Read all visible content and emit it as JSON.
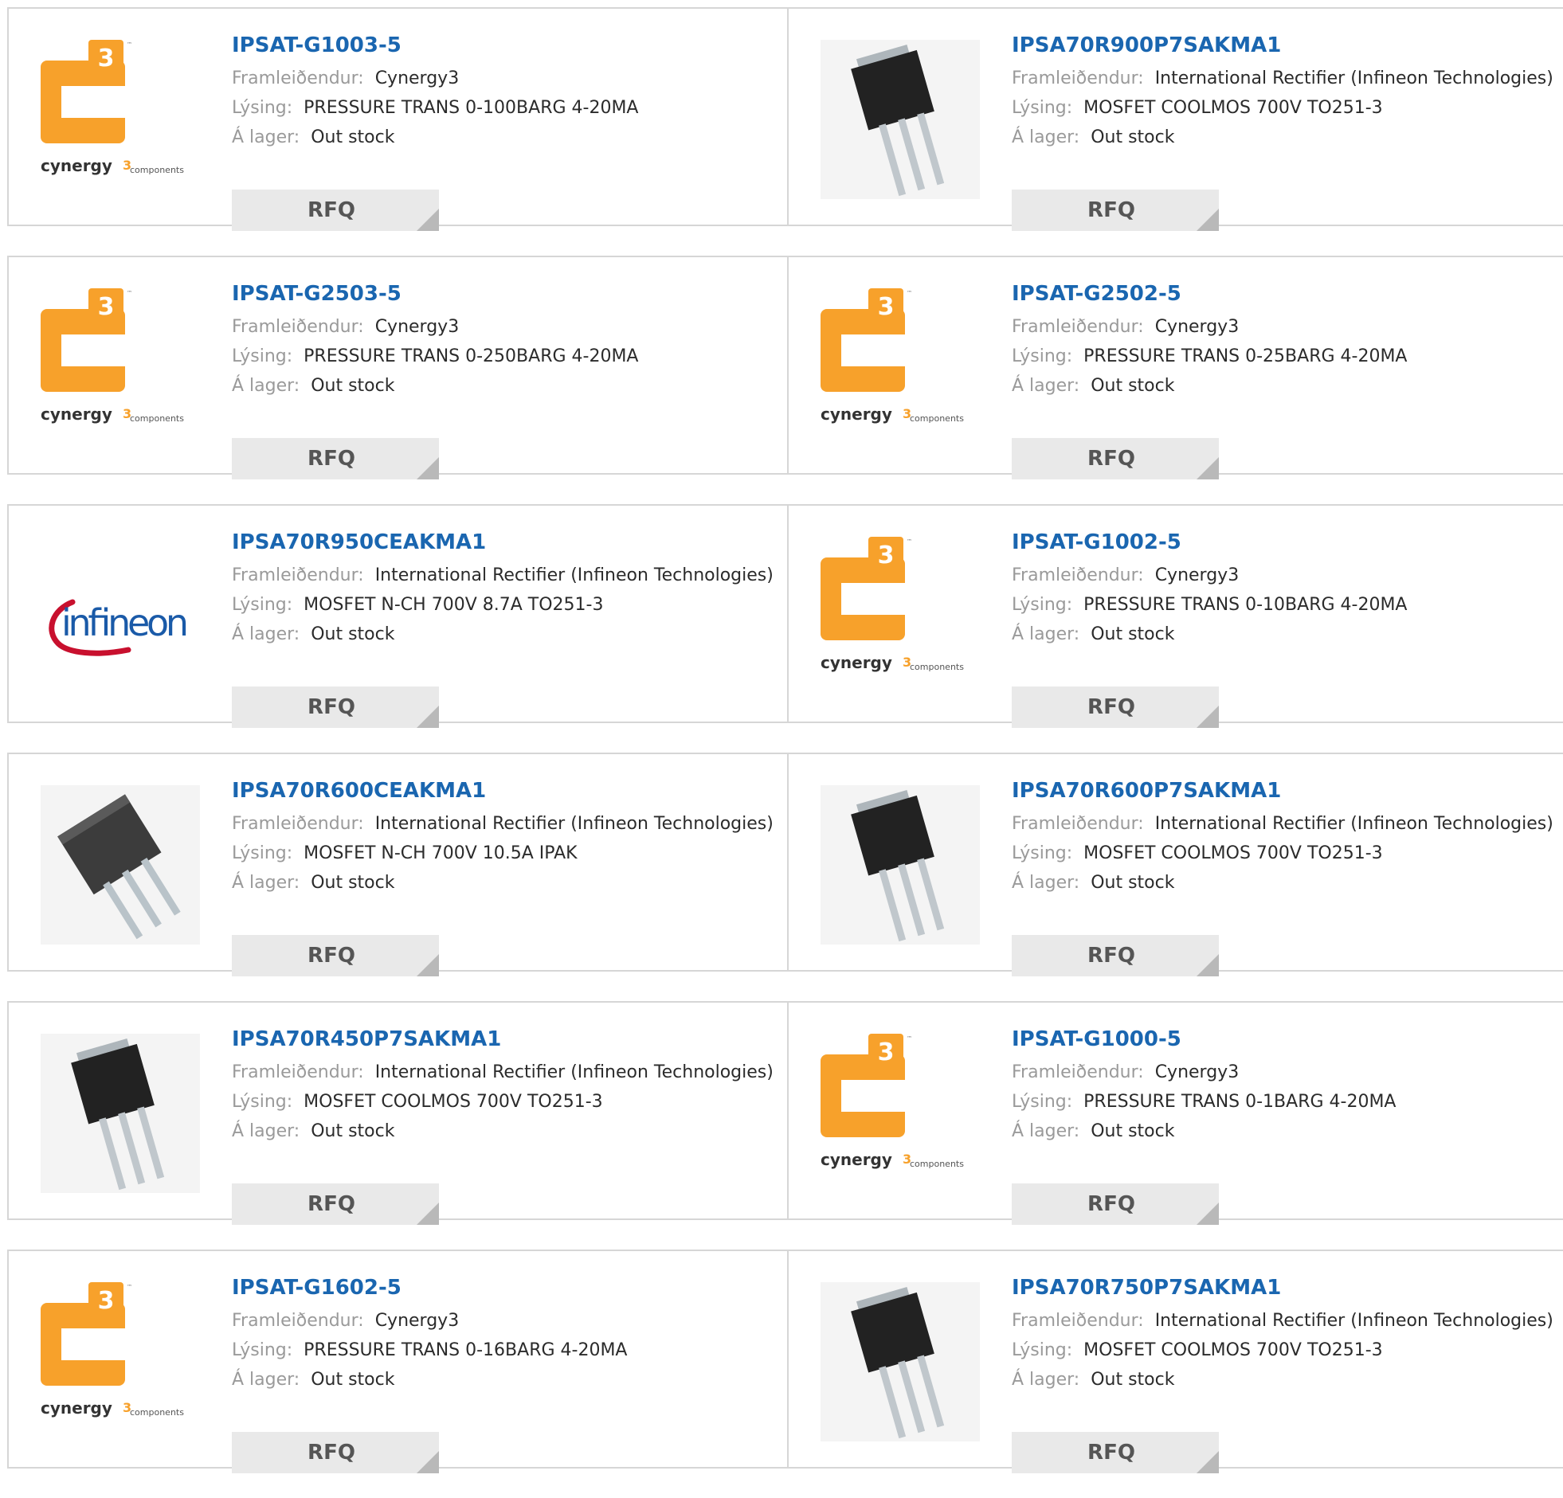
{
  "labels": {
    "manufacturer": "Framleiðendur:",
    "description": "Lýsing:",
    "stock": "Á lager:",
    "rfq": "RFQ"
  },
  "colors": {
    "part_link": "#1a66b0",
    "cynergy_orange": "#f7a12b",
    "infineon_blue": "#1a5aa8",
    "infineon_red": "#c8102e"
  },
  "logos": {
    "cynergy_text": "cynergy",
    "cynergy_sub": "components",
    "cynergy_mark": "3",
    "cynergy_tm": "™",
    "infineon_text": "infineon"
  },
  "rows": [
    [
      {
        "part": "IPSAT-G1003-5",
        "manufacturer": "Cynergy3",
        "description": "PRESSURE TRANS 0-100BARG 4-20MA",
        "stock": "Out stock",
        "image": "cynergy-logo"
      },
      {
        "part": "IPSA70R900P7SAKMA1",
        "manufacturer": "International Rectifier (Infineon Technologies)",
        "description": "MOSFET COOLMOS 700V TO251-3",
        "stock": "Out stock",
        "image": "transistor-tilted"
      }
    ],
    [
      {
        "part": "IPSAT-G2503-5",
        "manufacturer": "Cynergy3",
        "description": "PRESSURE TRANS 0-250BARG 4-20MA",
        "stock": "Out stock",
        "image": "cynergy-logo"
      },
      {
        "part": "IPSAT-G2502-5",
        "manufacturer": "Cynergy3",
        "description": "PRESSURE TRANS 0-25BARG 4-20MA",
        "stock": "Out stock",
        "image": "cynergy-logo"
      }
    ],
    [
      {
        "part": "IPSA70R950CEAKMA1",
        "manufacturer": "International Rectifier (Infineon Technologies)",
        "description": "MOSFET N-CH 700V 8.7A TO251-3",
        "stock": "Out stock",
        "image": "infineon-logo"
      },
      {
        "part": "IPSAT-G1002-5",
        "manufacturer": "Cynergy3",
        "description": "PRESSURE TRANS 0-10BARG 4-20MA",
        "stock": "Out stock",
        "image": "cynergy-logo"
      }
    ],
    [
      {
        "part": "IPSA70R600CEAKMA1",
        "manufacturer": "International Rectifier (Infineon Technologies)",
        "description": "MOSFET N-CH 700V 10.5A IPAK",
        "stock": "Out stock",
        "image": "transistor-ipak"
      },
      {
        "part": "IPSA70R600P7SAKMA1",
        "manufacturer": "International Rectifier (Infineon Technologies)",
        "description": "MOSFET COOLMOS 700V TO251-3",
        "stock": "Out stock",
        "image": "transistor-tilted"
      }
    ],
    [
      {
        "part": "IPSA70R450P7SAKMA1",
        "manufacturer": "International Rectifier (Infineon Technologies)",
        "description": "MOSFET COOLMOS 700V TO251-3",
        "stock": "Out stock",
        "image": "transistor-tilted"
      },
      {
        "part": "IPSAT-G1000-5",
        "manufacturer": "Cynergy3",
        "description": "PRESSURE TRANS 0-1BARG 4-20MA",
        "stock": "Out stock",
        "image": "cynergy-logo"
      }
    ],
    [
      {
        "part": "IPSAT-G1602-5",
        "manufacturer": "Cynergy3",
        "description": "PRESSURE TRANS 0-16BARG 4-20MA",
        "stock": "Out stock",
        "image": "cynergy-logo"
      },
      {
        "part": "IPSA70R750P7SAKMA1",
        "manufacturer": "International Rectifier (Infineon Technologies)",
        "description": "MOSFET COOLMOS 700V TO251-3",
        "stock": "Out stock",
        "image": "transistor-tilted"
      }
    ]
  ]
}
